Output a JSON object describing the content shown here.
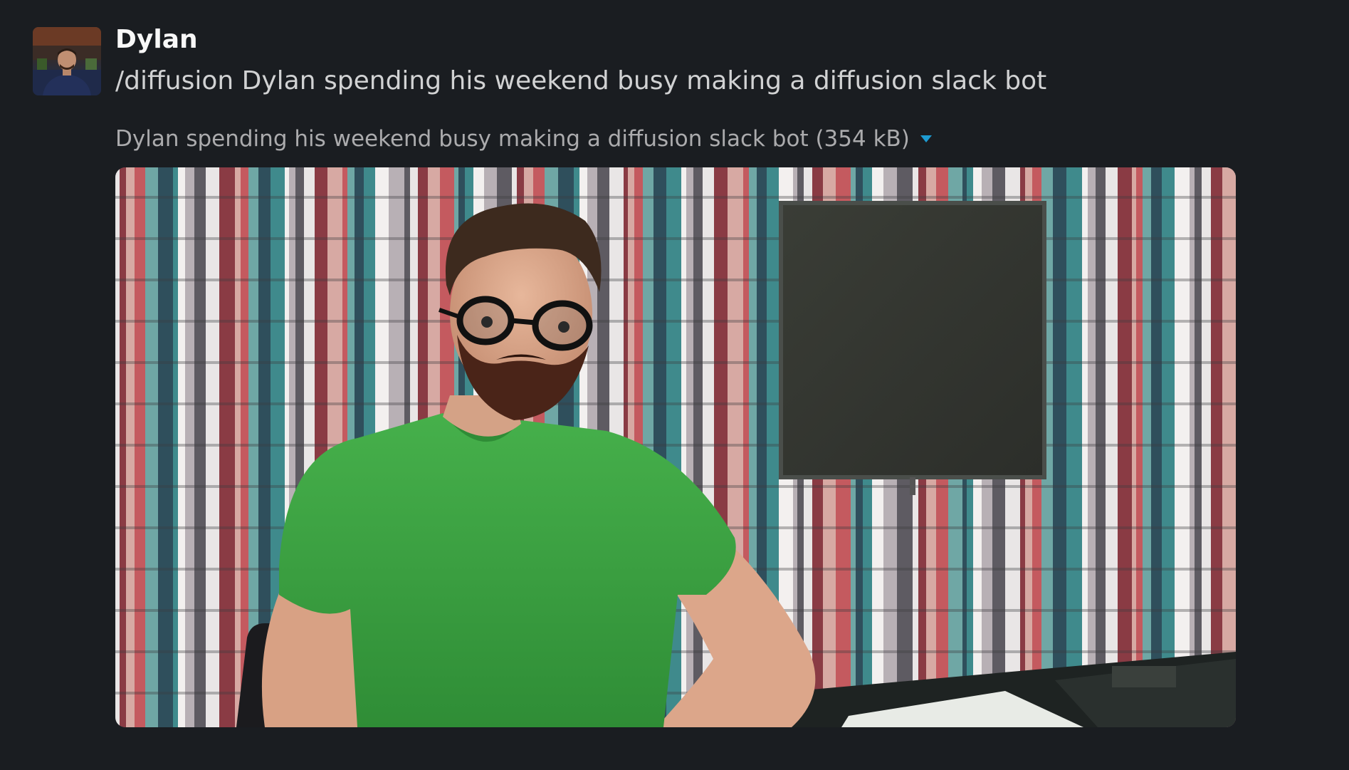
{
  "message": {
    "author": "Dylan",
    "text": "/diffusion Dylan spending his weekend busy making a diffusion slack bot",
    "avatar_alt": "Dylan avatar photo"
  },
  "attachment": {
    "file_label": "Dylan spending his weekend busy making a diffusion slack bot (354 kB)",
    "toggle_icon": "caret-down-icon",
    "image_description": "generated image: bearded man with glasses in green t-shirt at desk, monitor and striped bookshelf background"
  },
  "colors": {
    "background": "#1a1d21",
    "author": "#f8f8f8",
    "text": "#d1d2d3",
    "muted": "#ababad",
    "caret": "#1d9bd1",
    "shirt": "#3fa845"
  }
}
